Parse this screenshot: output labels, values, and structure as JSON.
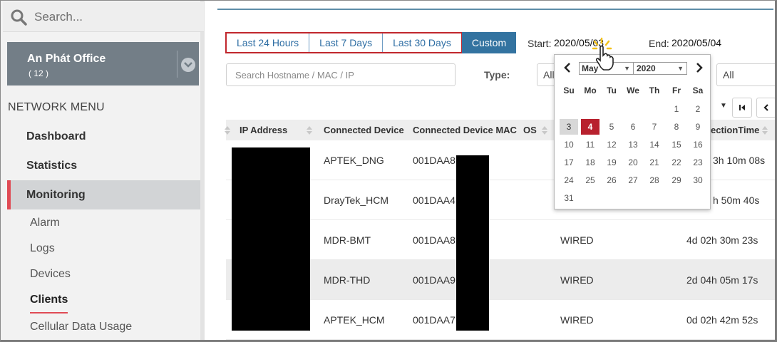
{
  "sidebar": {
    "search_placeholder": "Search...",
    "site": {
      "name": "An Phát Office",
      "count": "( 12 )"
    },
    "menu_heading": "NETWORK MENU",
    "items": [
      {
        "label": "Dashboard"
      },
      {
        "label": "Statistics"
      },
      {
        "label": "Monitoring"
      }
    ],
    "sub_items": [
      {
        "label": "Alarm"
      },
      {
        "label": "Logs"
      },
      {
        "label": "Devices"
      },
      {
        "label": "Clients"
      },
      {
        "label": "Cellular Data Usage"
      }
    ]
  },
  "toolbar": {
    "ranges": [
      "Last 24 Hours",
      "Last 7 Days",
      "Last 30 Days"
    ],
    "custom_label": "Custom",
    "start_label": "Start:",
    "start_value": "2020/05/03",
    "end_label": "End:",
    "end_value": "2020/05/04",
    "filter_placeholder": "Search Hostname / MAC / IP",
    "type_label": "Type:",
    "type_value": "All",
    "all_value": "All"
  },
  "calendar": {
    "month": "May",
    "year": "2020",
    "weekdays": [
      "Su",
      "Mo",
      "Tu",
      "We",
      "Th",
      "Fr",
      "Sa"
    ],
    "weeks": [
      [
        "",
        "",
        "",
        "",
        "",
        "1",
        "2"
      ],
      [
        "3",
        "4",
        "5",
        "6",
        "7",
        "8",
        "9"
      ],
      [
        "10",
        "11",
        "12",
        "13",
        "14",
        "15",
        "16"
      ],
      [
        "17",
        "18",
        "19",
        "20",
        "21",
        "22",
        "23"
      ],
      [
        "24",
        "25",
        "26",
        "27",
        "28",
        "29",
        "30"
      ],
      [
        "31",
        "",
        "",
        "",
        "",
        "",
        ""
      ]
    ],
    "selected": "3",
    "today": "4"
  },
  "table": {
    "columns": [
      "IP Address",
      "Connected Device",
      "Connected Device MAC",
      "OS",
      "ectionTime"
    ],
    "rows": [
      {
        "device": "APTEK_DNG",
        "mac": "001DAA8",
        "type": "",
        "time": "3h 10m 08s"
      },
      {
        "device": "DrayTek_HCM",
        "mac": "001DAA4",
        "type": "",
        "time": "h 50m 40s"
      },
      {
        "device": "MDR-BMT",
        "mac": "001DAA8",
        "type": "WIRED",
        "time": "4d 02h 30m 23s"
      },
      {
        "device": "MDR-THD",
        "mac": "001DAA9",
        "type": "WIRED",
        "time": "2d 04h 05m 17s"
      },
      {
        "device": "APTEK_HCM",
        "mac": "001DAA7",
        "type": "WIRED",
        "time": "0d 02h 42m 52s"
      }
    ]
  },
  "colors": {
    "accent": "#3373a0",
    "highlight_border": "#c1272d",
    "today": "#b8212e",
    "active_marker": "#e04b55"
  }
}
